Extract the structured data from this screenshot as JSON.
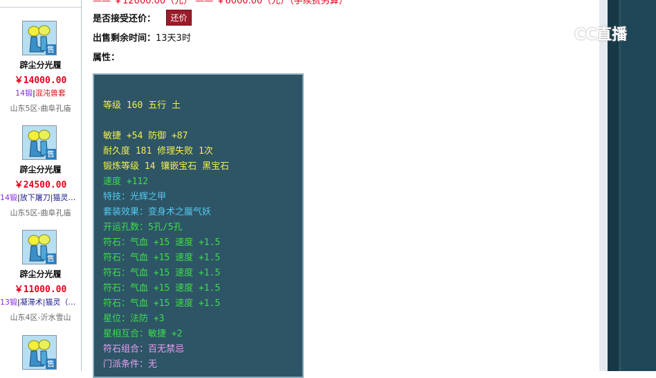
{
  "header": {
    "partial_top_text": "—— ￥12000.00（元） —— ￥6000.00（元）（手续费另算）",
    "accept_counter_label": "是否接受还价：",
    "counter_button": "还价",
    "remaining_label": "出售剩余时间：",
    "remaining_value": "13天3时",
    "attributes_label": "属性："
  },
  "sidebar": {
    "items": [
      {
        "name": "辟尘分光履",
        "price": "￥14000.00",
        "level_tag": "14锻",
        "sep": "|",
        "skill": "混沌兽套",
        "skill2": "",
        "server": "山东5区-曲阜孔庙",
        "sell_badge": "售"
      },
      {
        "name": "辟尘分光履",
        "price": "￥24500.00",
        "level_tag": "14锻",
        "sep": "|",
        "skill": "放下屠刀",
        "skill2": "|猫灵…",
        "server": "山东5区-曲阜孔庙",
        "sell_badge": "售"
      },
      {
        "name": "辟尘分光履",
        "price": "￥11000.00",
        "level_tag": "13锻",
        "sep": "|",
        "skill": "凝滞术",
        "skill2": "|猫灵（…",
        "server": "山东4区-沂水雪山",
        "sell_badge": "售"
      },
      {
        "name": "",
        "price": "",
        "level_tag": "",
        "sep": "",
        "skill": "",
        "skill2": "",
        "server": "",
        "sell_badge": "售"
      }
    ]
  },
  "attributes": {
    "lines": [
      {
        "text": "等级 160 五行 土",
        "color": "yellow"
      },
      {
        "text": "敏捷 +54 防御 +87",
        "color": "yellow"
      },
      {
        "text": "耐久度 181 修理失败 1次",
        "color": "yellow"
      },
      {
        "text": "锻炼等级 14 镶嵌宝石 黑宝石",
        "color": "yellow"
      },
      {
        "text": "速度 +112",
        "color": "green"
      },
      {
        "text": "特技：光辉之甲",
        "color": "blue"
      },
      {
        "text": "套装效果：变身术之蜃气妖",
        "color": "blue"
      },
      {
        "text": "开运孔数：5孔/5孔",
        "color": "green"
      },
      {
        "text": "符石：气血 +15 速度 +1.5",
        "color": "green"
      },
      {
        "text": "符石：气血 +15 速度 +1.5",
        "color": "green"
      },
      {
        "text": "符石：气血 +15 速度 +1.5",
        "color": "green"
      },
      {
        "text": "符石：气血 +15 速度 +1.5",
        "color": "green"
      },
      {
        "text": "符石：气血 +15 速度 +1.5",
        "color": "green"
      },
      {
        "text": "星位：法防 +3",
        "color": "green"
      },
      {
        "text": "星相互合：敏捷 +2",
        "color": "green"
      },
      {
        "text": "符石组合：百无禁忌",
        "color": "pink"
      },
      {
        "text": "门派条件：无",
        "color": "pink"
      }
    ]
  },
  "watermark": {
    "text": "CC直播",
    "icon": "cc-logo-icon"
  },
  "colors": {
    "price_red": "#e3001b",
    "counter_btn": "#9b1b2b",
    "attr_bg": "#2d5566",
    "right_panel": "#1e4656"
  }
}
